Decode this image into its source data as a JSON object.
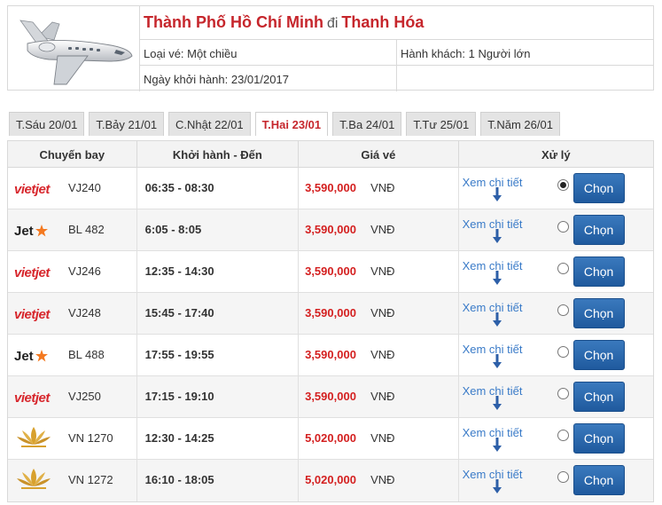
{
  "header": {
    "from_city": "Thành Phố Hồ Chí Minh",
    "connector": "đi",
    "to_city": "Thanh Hóa",
    "ticket_type": "Loại vé: Một chiều",
    "passengers": "Hành khách: 1 Người lớn",
    "departure_date": "Ngày khởi hành: 23/01/2017",
    "plane_icon": "airplane-icon"
  },
  "tabs": [
    {
      "label": "T.Sáu 20/01",
      "active": false
    },
    {
      "label": "T.Bảy 21/01",
      "active": false
    },
    {
      "label": "C.Nhật 22/01",
      "active": false
    },
    {
      "label": "T.Hai 23/01",
      "active": true
    },
    {
      "label": "T.Ba 24/01",
      "active": false
    },
    {
      "label": "T.Tư 25/01",
      "active": false
    },
    {
      "label": "T.Năm 26/01",
      "active": false
    }
  ],
  "table": {
    "headers": {
      "flight": "Chuyến bay",
      "time": "Khởi hành - Đến",
      "price": "Giá vé",
      "action": "Xử lý"
    },
    "rows": [
      {
        "airline": "vietjet",
        "code": "VJ240",
        "time": "06:35 - 08:30",
        "price": "3,590,000",
        "currency": "VNĐ",
        "detail": "Xem chi tiết",
        "selected": true,
        "button": "Chọn"
      },
      {
        "airline": "jetstar",
        "code": "BL 482",
        "time": "6:05 - 8:05",
        "price": "3,590,000",
        "currency": "VNĐ",
        "detail": "Xem chi tiết",
        "selected": false,
        "button": "Chọn"
      },
      {
        "airline": "vietjet",
        "code": "VJ246",
        "time": "12:35 - 14:30",
        "price": "3,590,000",
        "currency": "VNĐ",
        "detail": "Xem chi tiết",
        "selected": false,
        "button": "Chọn"
      },
      {
        "airline": "vietjet",
        "code": "VJ248",
        "time": "15:45 - 17:40",
        "price": "3,590,000",
        "currency": "VNĐ",
        "detail": "Xem chi tiết",
        "selected": false,
        "button": "Chọn"
      },
      {
        "airline": "jetstar",
        "code": "BL 488",
        "time": "17:55 - 19:55",
        "price": "3,590,000",
        "currency": "VNĐ",
        "detail": "Xem chi tiết",
        "selected": false,
        "button": "Chọn"
      },
      {
        "airline": "vietjet",
        "code": "VJ250",
        "time": "17:15 - 19:10",
        "price": "3,590,000",
        "currency": "VNĐ",
        "detail": "Xem chi tiết",
        "selected": false,
        "button": "Chọn"
      },
      {
        "airline": "vietnam-airlines",
        "code": "VN 1270",
        "time": "12:30 - 14:25",
        "price": "5,020,000",
        "currency": "VNĐ",
        "detail": "Xem chi tiết",
        "selected": false,
        "button": "Chọn"
      },
      {
        "airline": "vietnam-airlines",
        "code": "VN 1272",
        "time": "16:10 - 18:05",
        "price": "5,020,000",
        "currency": "VNĐ",
        "detail": "Xem chi tiết",
        "selected": false,
        "button": "Chọn"
      }
    ]
  },
  "logos": {
    "vietjet": "vietjet",
    "jetstar": "Jet"
  },
  "colors": {
    "accent_red": "#c6262c",
    "price_red": "#d42020",
    "link_blue": "#3a7bc8",
    "button_blue": "#2a67ad",
    "jetstar_orange": "#f47920",
    "vna_gold": "#d8a12e"
  }
}
